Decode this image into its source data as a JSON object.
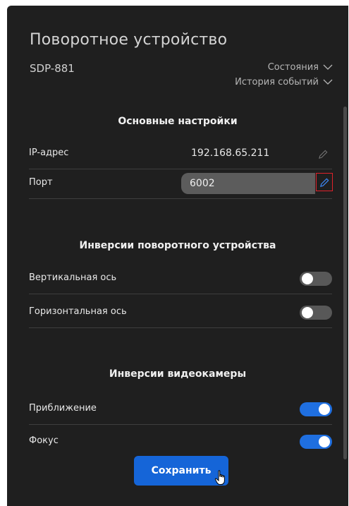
{
  "header": {
    "title": "Поворотное устройство",
    "model": "SDP-881",
    "states_link": "Состояния",
    "history_link": "История событий"
  },
  "sections": {
    "main_settings": {
      "title": "Основные настройки",
      "ip_label": "IP-адрес",
      "ip_value": "192.168.65.211",
      "port_label": "Порт",
      "port_value": "6002"
    },
    "rotator_inversion": {
      "title": "Инверсии поворотного устройства",
      "vertical_label": "Вертикальная ось",
      "vertical_on": false,
      "horizontal_label": "Горизонтальная ось",
      "horizontal_on": false
    },
    "camera_inversion": {
      "title": "Инверсии видеокамеры",
      "zoom_label": "Приближение",
      "zoom_on": true,
      "focus_label": "Фокус",
      "focus_on": true
    }
  },
  "footer": {
    "save_label": "Сохранить"
  },
  "colors": {
    "panel_bg": "#1f1f1f",
    "accent": "#1565d8",
    "switch_on": "#1f6fe0",
    "switch_off": "#585858",
    "focus_border": "#e0222b"
  }
}
